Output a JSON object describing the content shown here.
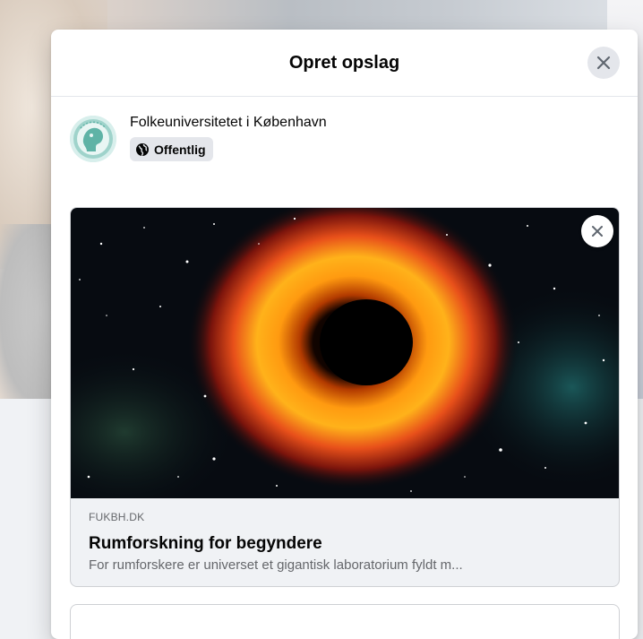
{
  "dialog": {
    "title": "Opret opslag",
    "close_icon": "close-icon"
  },
  "author": {
    "name": "Folkeuniversitetet i København",
    "privacy_label": "Offentlig",
    "privacy_icon": "globe-icon"
  },
  "link_preview": {
    "domain": "FUKBH.DK",
    "title": "Rumforskning for begyndere",
    "description": "For rumforskere er universet et gigantisk laboratorium fyldt m..."
  },
  "colors": {
    "button_bg": "#e4e6eb",
    "card_bg": "#f0f2f5",
    "secondary_text": "#65676b"
  }
}
